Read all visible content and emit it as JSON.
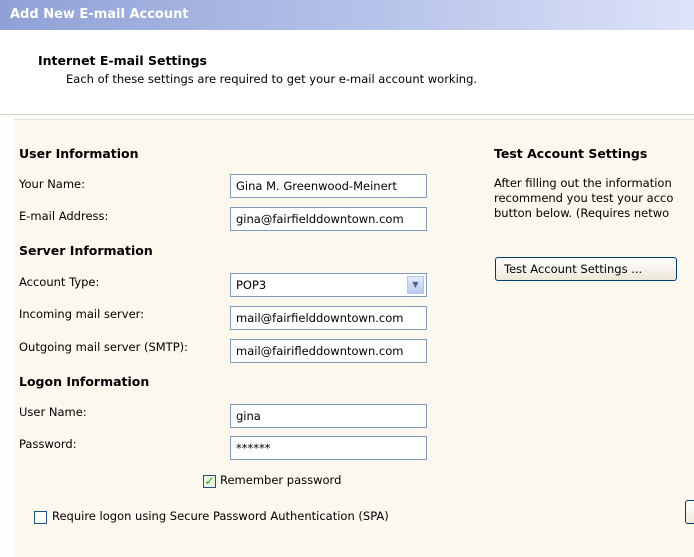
{
  "window": {
    "title": "Add New E-mail Account"
  },
  "header": {
    "title": "Internet E-mail Settings",
    "subtitle": "Each of these settings are required to get your e-mail account working."
  },
  "user_info": {
    "heading": "User Information",
    "name_label": "Your Name:",
    "name_value": "Gina M. Greenwood-Meinert",
    "email_label": "E-mail Address:",
    "email_value": "gina@fairfielddowntown.com"
  },
  "server_info": {
    "heading": "Server Information",
    "account_type_label": "Account Type:",
    "account_type_value": "POP3",
    "incoming_label": "Incoming mail server:",
    "incoming_value": "mail@fairfielddowntown.com",
    "outgoing_label": "Outgoing mail server (SMTP):",
    "outgoing_value": "mail@fairifleddowntown.com"
  },
  "logon_info": {
    "heading": "Logon Information",
    "username_label": "User Name:",
    "username_value": "gina",
    "password_label": "Password:",
    "password_value": "******",
    "remember_label": "Remember password",
    "remember_checked": true,
    "spa_label": "Require logon using Secure Password Authentication (SPA)",
    "spa_checked": false
  },
  "test_settings": {
    "heading": "Test Account Settings",
    "desc_line1": "After filling out the information",
    "desc_line2": "recommend you test your acco",
    "desc_line3": "button below. (Requires netwo",
    "button_label": "Test Account Settings ..."
  },
  "icons": {
    "dropdown": "chevron-down-icon",
    "check": "checkmark-icon"
  },
  "colors": {
    "title_bar": "#8fa1d6",
    "panel_bg": "#fcf8ee",
    "field_border": "#7f9db9",
    "check_green": "#21a121"
  }
}
